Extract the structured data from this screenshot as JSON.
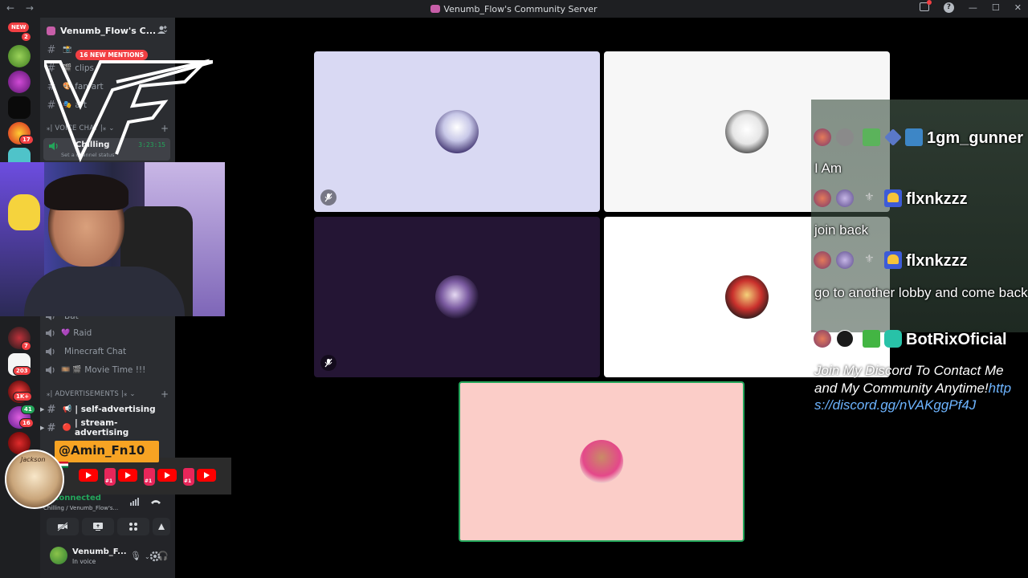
{
  "window": {
    "title": "Venumb_Flow's Community Server",
    "nav_back": "←",
    "nav_forward": "→"
  },
  "guilds": {
    "new_label": "NEW",
    "badges": [
      "2",
      "17",
      "7",
      "203",
      "1K+",
      "41",
      "16"
    ]
  },
  "sidebar": {
    "server_name": "Venumb_Flow's C...",
    "mentions_pill": "16 NEW MENTIONS",
    "channels_top": [
      {
        "label": "",
        "emoji": "📸"
      },
      {
        "label": "clips",
        "emoji": "🎬"
      },
      {
        "label": "fan-art",
        "emoji": "🎨"
      },
      {
        "label": "art",
        "emoji": "🎭"
      }
    ],
    "voice_category": "VOICE CHAT",
    "active_voice": {
      "name": "Chilling",
      "timer": "3:23:15",
      "status": "Set a channel status"
    },
    "voice_channels": [
      {
        "label": "Bat",
        "emoji": ""
      },
      {
        "label": "Raid",
        "emoji": "💜"
      },
      {
        "label": "Minecraft Chat",
        "emoji": ""
      },
      {
        "label": "Movie Time !!!",
        "emoji": "🎞️ 🎬"
      }
    ],
    "ads_category": "ADVERTISEMENTS",
    "ads_channels": [
      {
        "label": "| self-advertising",
        "emoji": "📢"
      },
      {
        "label": "| stream-advertising",
        "emoji": "🔴"
      }
    ]
  },
  "voice_panel": {
    "status": "Connected",
    "channel": "Chilling / Venumb_Flow's..."
  },
  "user": {
    "name": "Venumb_F...",
    "status": "In voice"
  },
  "overlay": {
    "handle": "@Amin_Fn10",
    "sticker_text": "Jackson",
    "hand_label": "#1"
  },
  "chat": {
    "messages": [
      {
        "user": "1gm_gunner",
        "text": "I Am"
      },
      {
        "user": "flxnkzzz",
        "text": "join back"
      },
      {
        "user": "flxnkzzz",
        "text": "go to another lobby and come back"
      },
      {
        "user": "BotRixOficial",
        "text": ""
      }
    ],
    "promo": "Join My Discord To Contact Me and My Community Anytime!",
    "promo_link": "https://discord.gg/nVAKggPf4J"
  },
  "colors": {
    "tile1": "#d9d9f3",
    "tile2": "#f7f7f7",
    "tile3": "#241534",
    "tile4": "#ffffff",
    "tile5": "#fbcdc8",
    "speaking": "#23a55a",
    "accent": "#f23f43"
  }
}
